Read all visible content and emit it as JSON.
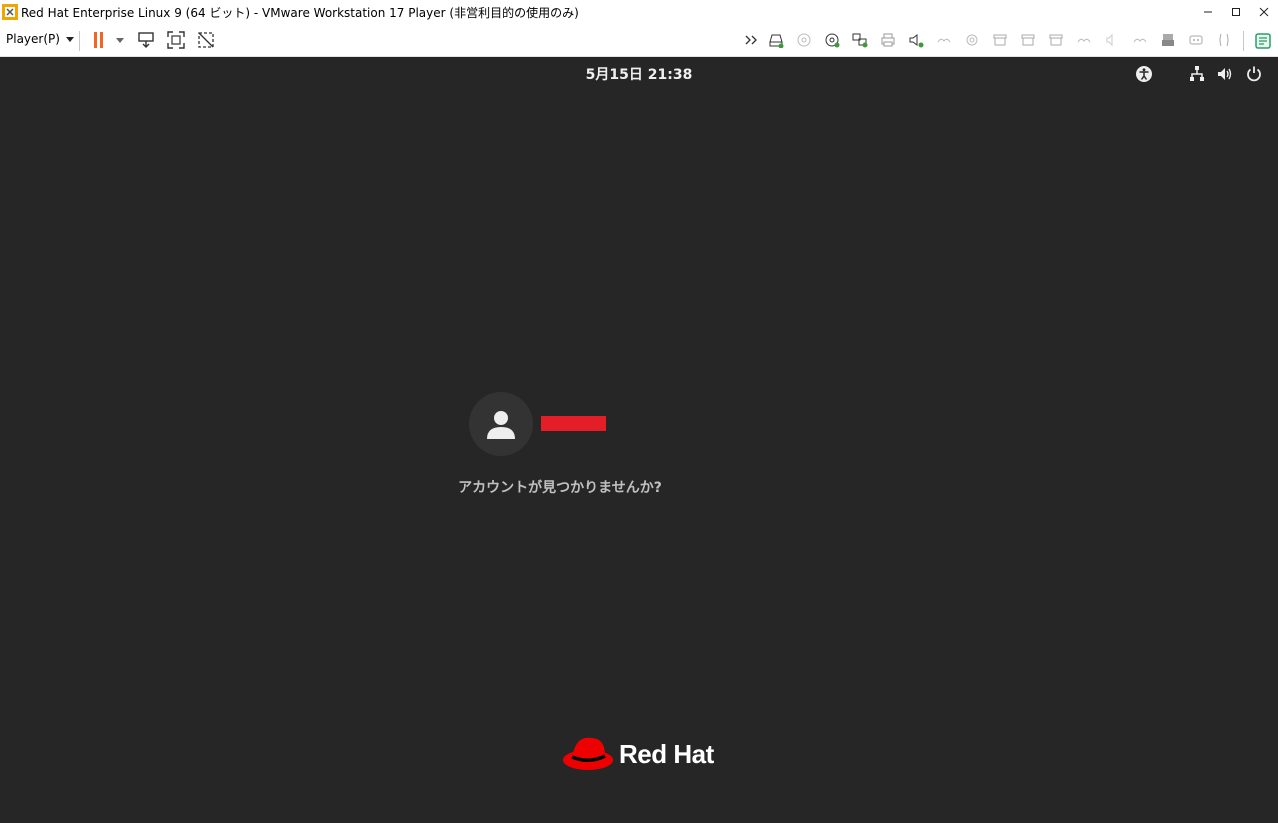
{
  "window": {
    "title": "Red Hat Enterprise Linux 9 (64 ビット) - VMware Workstation 17 Player (非営利目的の使用のみ)",
    "controls": {
      "minimize": "–",
      "maximize": "□",
      "close": "✕"
    }
  },
  "toolbar": {
    "player_menu_label": "Player(P)",
    "pause_color": "#f26522",
    "devices_color_active": "#3c9a3c"
  },
  "guest": {
    "clock": "5月15日  21:38",
    "login": {
      "user_name_redacted": true,
      "not_listed_label": "アカウントが見つかりませんか?"
    },
    "logo_text": "Red Hat",
    "brand_red": "#ee0000"
  }
}
